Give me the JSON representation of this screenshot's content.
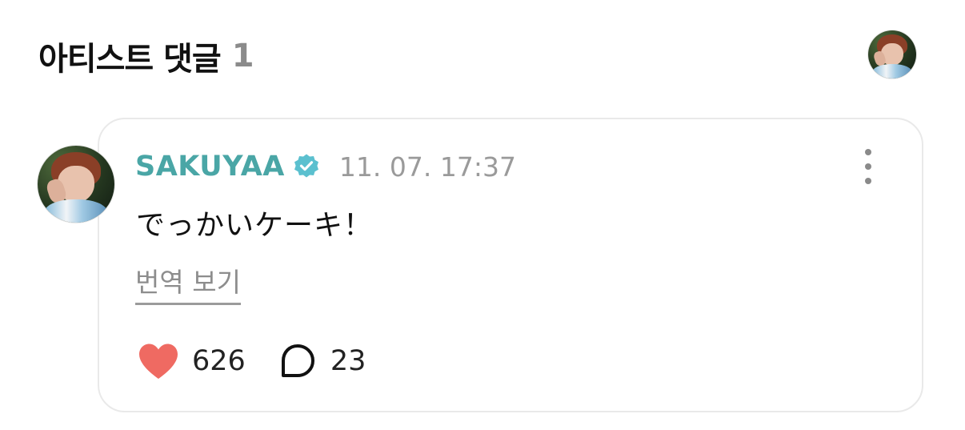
{
  "header": {
    "title": "아티스트 댓글",
    "count": "1",
    "avatar_icon": "profile-avatar-icon"
  },
  "comment": {
    "author": "SAKUYAA",
    "verified_icon": "verified-badge-icon",
    "timestamp": "11. 07. 17:37",
    "body": "でっかいケーキ！",
    "translate_label": "번역 보기",
    "likes": "626",
    "replies": "23",
    "more_icon": "more-vertical-icon"
  },
  "colors": {
    "author": "#4aa6a6",
    "verified_badge": "#5bc0cf",
    "heart": "#ef6a62",
    "muted": "#9a9a9a",
    "card_border": "#e9e9e9"
  }
}
